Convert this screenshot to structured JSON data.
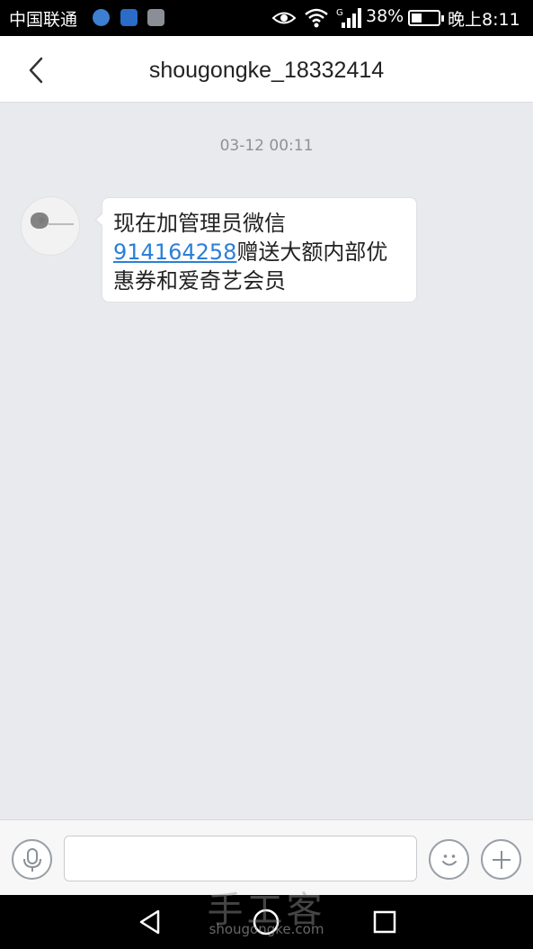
{
  "status_bar": {
    "carrier": "中国联通",
    "battery_percent": "38%",
    "battery_level": 0.38,
    "network": "G",
    "time": "晚上8:11",
    "icons": [
      "app-s-icon",
      "app-radio-icon",
      "app-image-icon",
      "eye-icon",
      "wifi-icon",
      "signal-icon",
      "battery-icon"
    ]
  },
  "header": {
    "title": "shougongke_18332414",
    "back_icon": "chevron-left-icon"
  },
  "chat": {
    "timestamp": "03-12 00:11",
    "messages": [
      {
        "text_before": "现在加管理员微信",
        "link": "914164258",
        "text_after": "赠送大额内部优惠券和爱奇艺会员"
      }
    ]
  },
  "input_bar": {
    "mic_icon": "microphone-icon",
    "input_value": "",
    "emoji_icon": "smiley-icon",
    "plus_icon": "plus-icon"
  },
  "watermark": {
    "text": "手工客",
    "sub": "shougongke.com"
  },
  "nav_bar": {
    "icons": [
      "nav-back-icon",
      "nav-home-icon",
      "nav-recent-icon"
    ]
  },
  "colors": {
    "link": "#2b7fd6",
    "chat_background": "#e8eaee",
    "bubble": "#ffffff"
  }
}
